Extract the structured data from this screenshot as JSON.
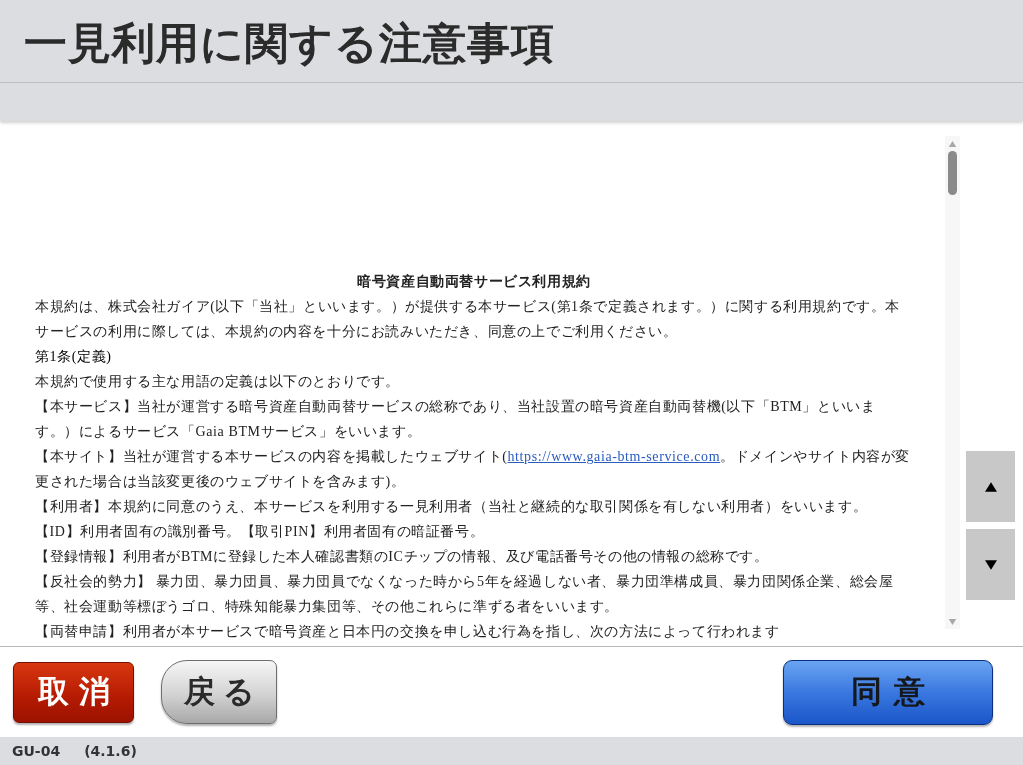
{
  "header": {
    "title": "一見利用に関する注意事項"
  },
  "document": {
    "title": "暗号資産自動両替サービス利用規約",
    "paragraphs": [
      {
        "kind": "text",
        "text": "本規約は、株式会社ガイア(以下「当社」といいます。）が提供する本サービス(第1条で定義されます。）に関する利用規約です。本サービスの利用に際しては、本規約の内容を十分にお読みいただき、同意の上でご利用ください。"
      },
      {
        "kind": "heading",
        "text": "第1条(定義)"
      },
      {
        "kind": "text",
        "text": "本規約で使用する主な用語の定義は以下のとおりです。"
      },
      {
        "kind": "text",
        "text": "【本サービス】当社が運営する暗号資産自動両替サービスの総称であり、当社設置の暗号資産自動両替機(以下「BTM」といいます。）によるサービス「Gaia BTMサービス」をいいます。"
      },
      {
        "kind": "link",
        "before": "【本サイト】当社が運営する本サービスの内容を掲載したウェブサイト(",
        "link": "https://www.gaia-btm-service.com",
        "after": "。ドメインやサイト内容が変更された場合は当該変更後のウェブサイトを含みます)。"
      },
      {
        "kind": "text",
        "text": "【利用者】本規約に同意のうえ、本サービスを利用する一見利用者（当社と継続的な取引関係を有しない利用者）をいいます。"
      },
      {
        "kind": "text",
        "text": "【ID】利用者固有の識別番号。【取引PIN】利用者固有の暗証番号。"
      },
      {
        "kind": "text",
        "text": "【登録情報】利用者がBTMに登録した本人確認書類のICチップの情報、及び電話番号その他の情報の総称です。"
      },
      {
        "kind": "text",
        "text": "【反社会的勢力】 暴力団、暴力団員、暴力団員でなくなった時から5年を経過しない者、暴力団準構成員、暴力団関係企業、総会屋等、社会運動等標ぼうゴロ、特殊知能暴力集団等、その他これらに準ずる者をいいます。"
      },
      {
        "kind": "text",
        "text": "【両替申請】利用者が本サービスで暗号資産と日本円の交換を申し込む行為を指し、次の方法によって行われます"
      }
    ]
  },
  "buttons": [
    {
      "kind": "cancel",
      "label": "取消",
      "disabled": false
    },
    {
      "kind": "back",
      "label": "戻る",
      "disabled": false
    },
    {
      "kind": "agree",
      "label": "同意",
      "disabled": true
    }
  ],
  "status_bar": {
    "screen_id": "GU-04",
    "version": "(4.1.6)"
  }
}
